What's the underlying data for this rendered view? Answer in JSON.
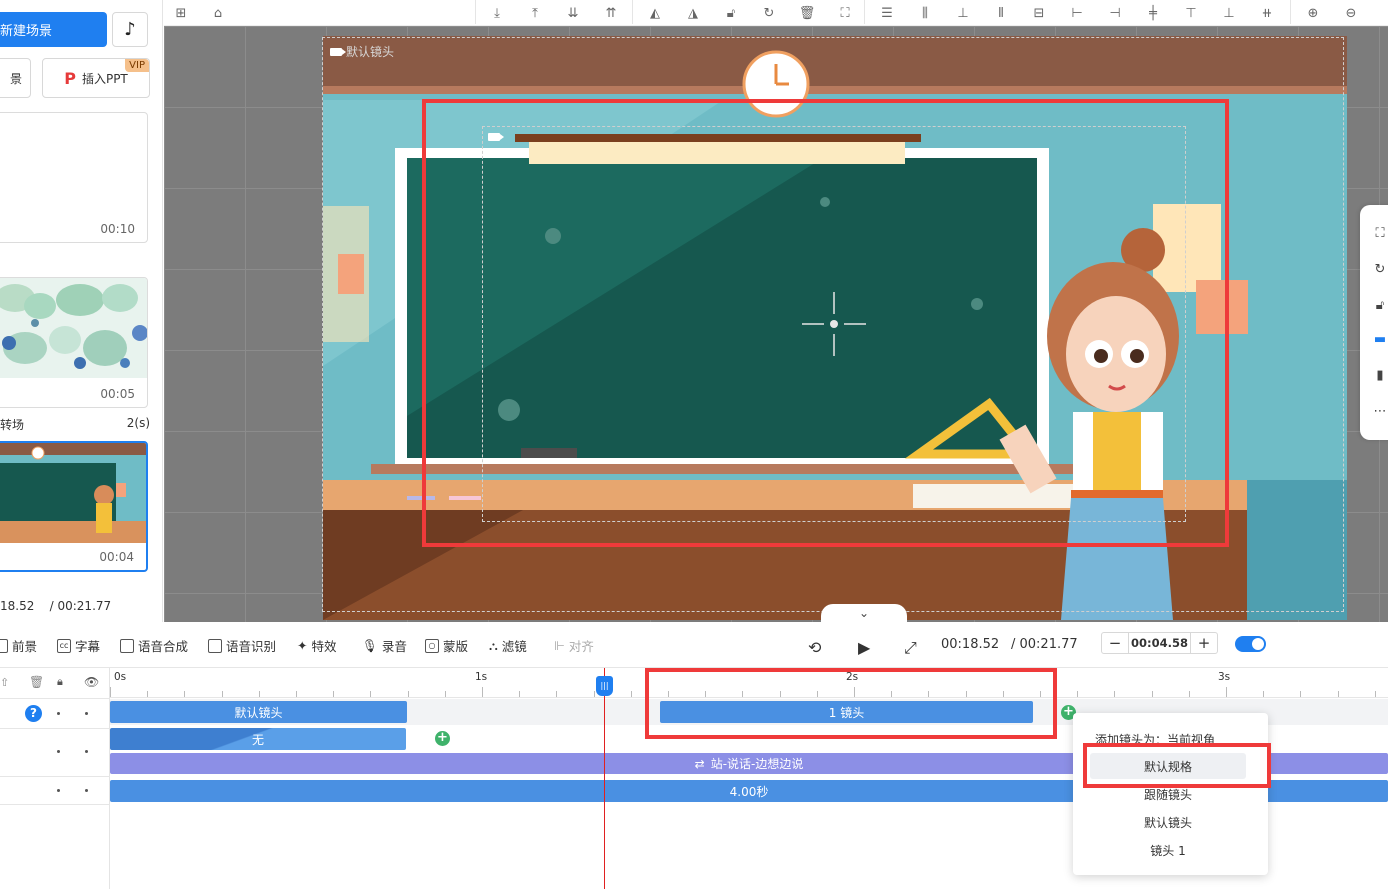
{
  "left_panel": {
    "new_scene_label": "新建场景",
    "partial_button_label": "景",
    "insert_ppt_label": "插入PPT",
    "vip_badge": "VIP",
    "scenes": [
      {
        "time": "00:10"
      },
      {
        "time": "00:05"
      },
      {
        "time": "00:04"
      }
    ],
    "transition_label": "转场",
    "transition_duration": "2(s)",
    "current_time": "18.52",
    "total_time": "/ 00:21.77"
  },
  "canvas": {
    "default_lens_label": "默认镜头"
  },
  "bottom_bar": {
    "items": [
      {
        "label": "前景",
        "icon": "foreground-icon"
      },
      {
        "label": "字幕",
        "icon": "subtitle-icon"
      },
      {
        "label": "语音合成",
        "icon": "tts-icon"
      },
      {
        "label": "语音识别",
        "icon": "speech-recognition-icon"
      },
      {
        "label": "特效",
        "icon": "effects-icon"
      },
      {
        "label": "录音",
        "icon": "mic-icon"
      },
      {
        "label": "蒙版",
        "icon": "mask-icon"
      },
      {
        "label": "滤镜",
        "icon": "filter-icon"
      }
    ],
    "align_label": "对齐",
    "current_time": "00:18.52",
    "total_time": "/ 00:21.77",
    "duration_value": "00:04.58",
    "minus": "−",
    "plus": "+"
  },
  "timeline": {
    "ruler": [
      "0s",
      "1s",
      "2s",
      "3s"
    ],
    "tracks": {
      "lens_clip_1": "默认镜头",
      "lens_clip_2": "1 镜头",
      "transition_clip": "无",
      "action_clip": "站-说话-边想边说",
      "duration_clip": "4.00秒"
    }
  },
  "popup": {
    "title": "添加镜头为：当前视角",
    "items": [
      "默认规格",
      "跟随镜头",
      "默认镜头",
      "镜头 1"
    ]
  },
  "colors": {
    "accent": "#1f7ff0",
    "highlight_red": "#ef3a3a",
    "clip_blue": "#4a90e2",
    "clip_purple": "#8c8fe6",
    "keyframe_green": "#3fb26b"
  }
}
